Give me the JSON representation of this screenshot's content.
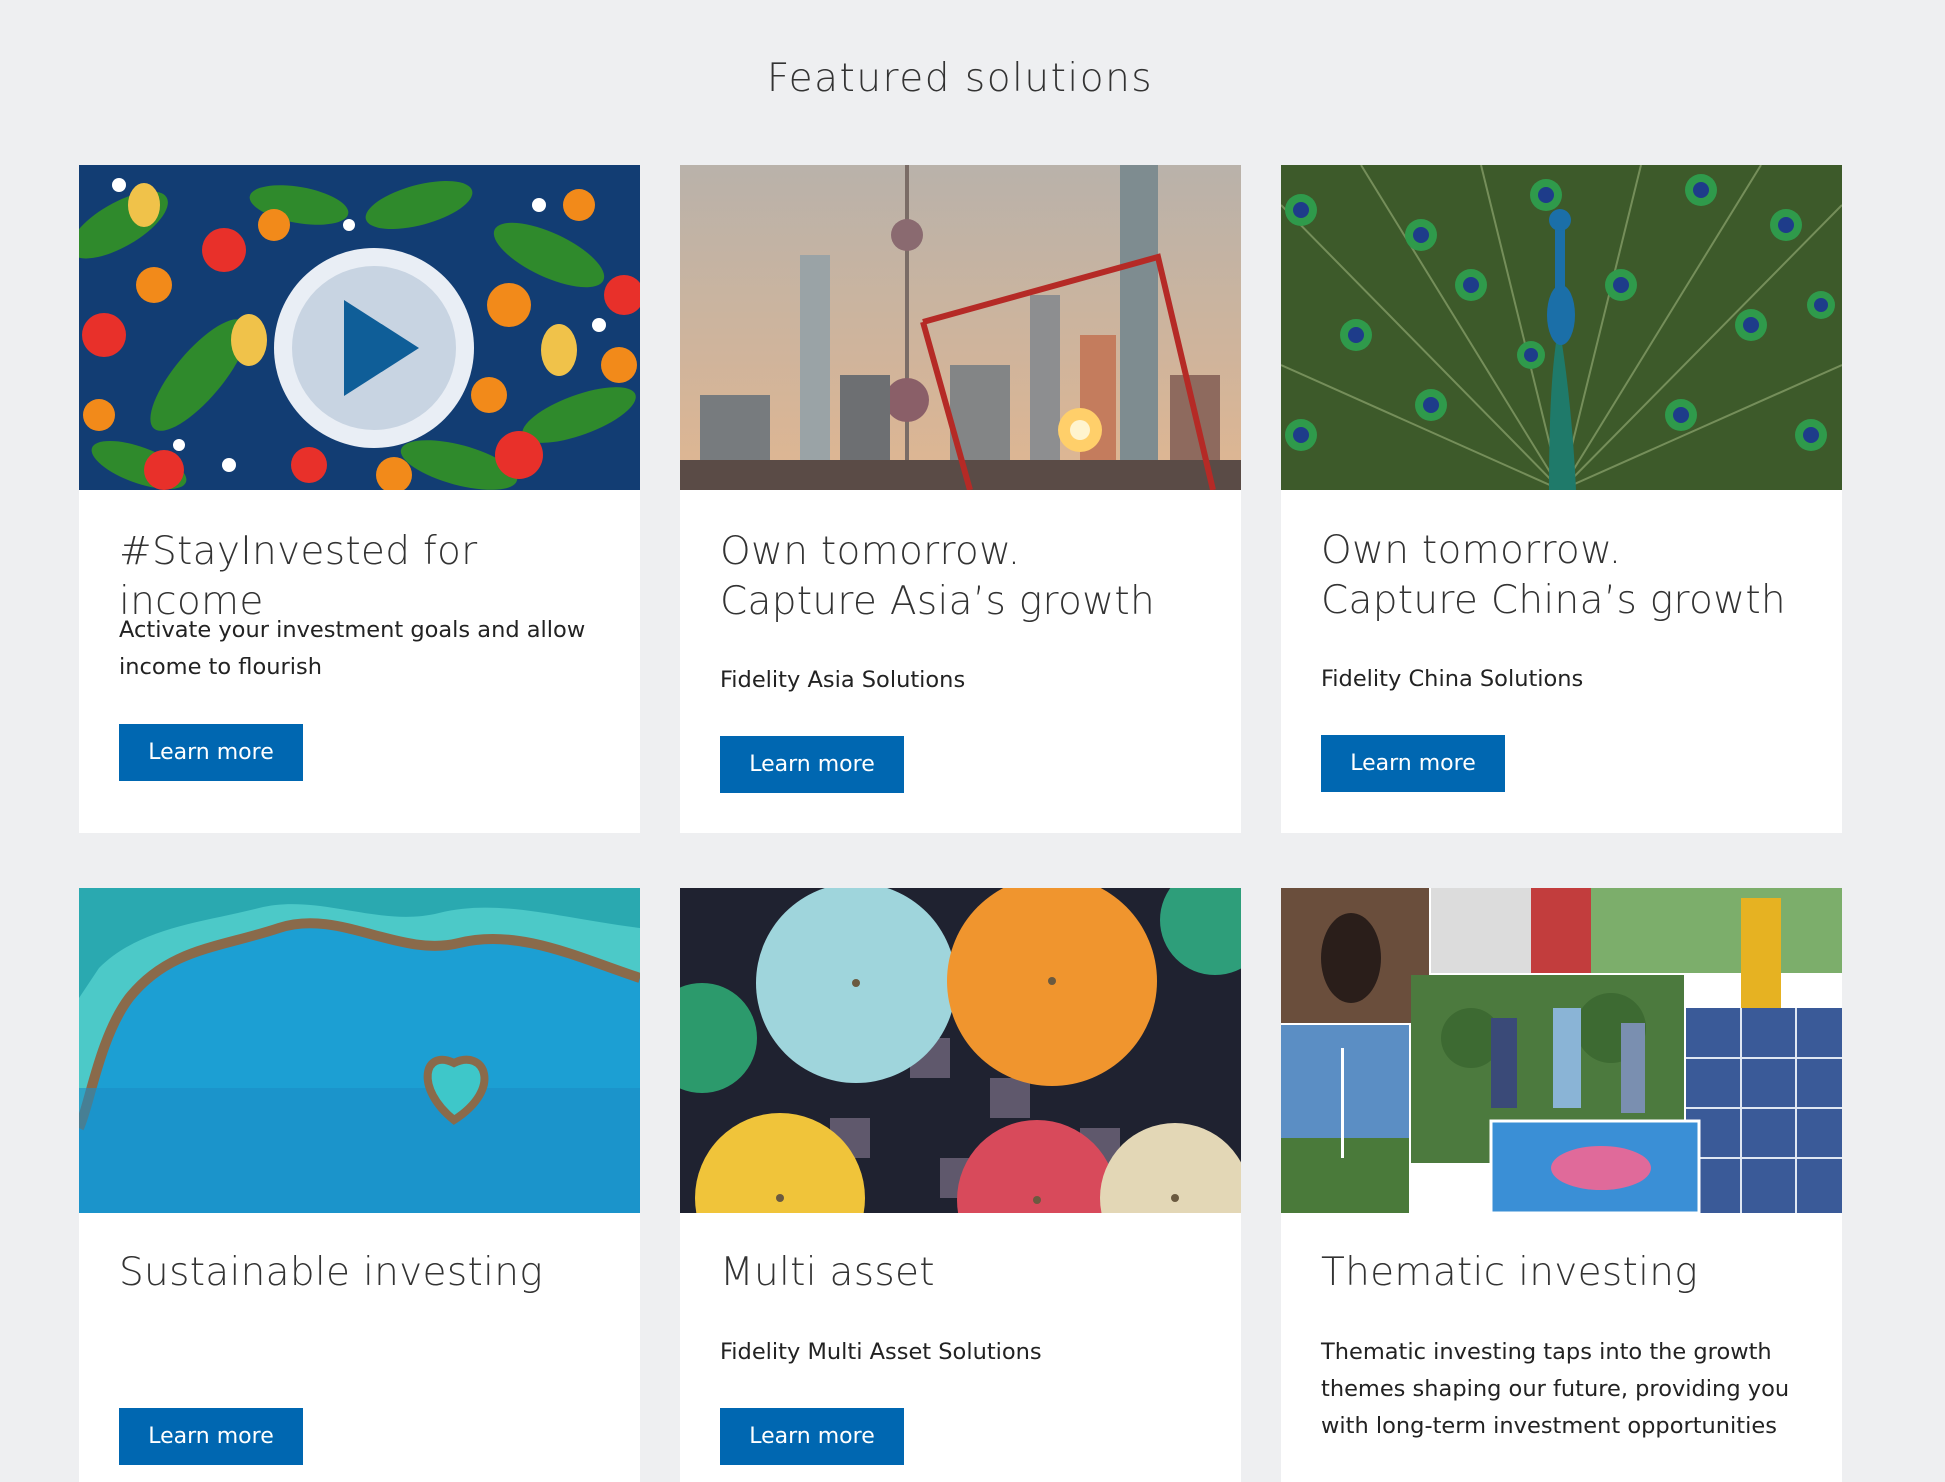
{
  "section": {
    "title": "Featured solutions"
  },
  "cards": [
    {
      "title": "#StayInvested for income",
      "description": "Activate your investment goals and allow income to flourish",
      "button": "Learn more",
      "image": "fruit-illustration-video"
    },
    {
      "title": "Own tomorrow. Capture Asia’s growth",
      "description": "Fidelity Asia Solutions",
      "button": "Learn more",
      "image": "asia-skyline"
    },
    {
      "title": "Own tomorrow. Capture China’s growth",
      "description": "Fidelity China Solutions",
      "button": "Learn more",
      "image": "peacock"
    },
    {
      "title": "Sustainable investing",
      "description": "",
      "button": "Learn more",
      "image": "heart-reef"
    },
    {
      "title": "Multi asset",
      "description": "Fidelity Multi Asset Solutions",
      "button": "Learn more",
      "image": "paper-umbrellas"
    },
    {
      "title": "Thematic investing",
      "description": "Thematic investing taps into the growth themes shaping our future, providing you with long-term investment opportunities",
      "button": "Learn more",
      "image": "thematic-collage"
    }
  ],
  "colors": {
    "background": "#eeeff1",
    "button": "#0067b1",
    "card": "#ffffff"
  }
}
